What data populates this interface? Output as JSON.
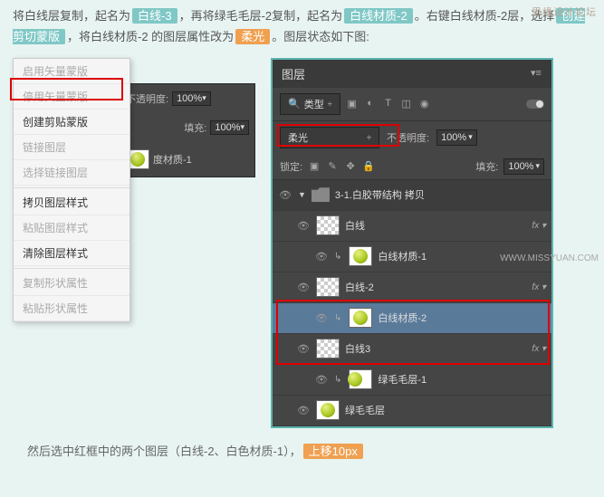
{
  "watermark": "思缘设计论坛",
  "watermark2": "WWW.MISSYUAN.COM",
  "instruction": {
    "p1_a": "将白线层复制，起名为",
    "tag1": "白线-3",
    "p1_b": "，再将绿毛毛层-2复制，起名为",
    "tag2": "白线材质-2",
    "p1_c": "。右键白线材质-2层，选择",
    "tag3": "创建剪切蒙版",
    "p1_d": "，将白线材质-2 的图层属性改为",
    "tag4": "柔光",
    "p1_e": "。图层状态如下图:"
  },
  "context_menu": {
    "i0a": "启用矢量蒙版",
    "i0b": "停用矢量蒙版",
    "i1": "创建剪贴蒙版",
    "i2": "链接图层",
    "i3": "选择链接图层",
    "i4": "拷贝图层样式",
    "i5": "粘贴图层样式",
    "i6": "清除图层样式",
    "i7": "复制形状属性",
    "i8": "粘贴形状属性"
  },
  "mini_panel": {
    "opacity_lbl": "不透明度:",
    "opacity": "100%",
    "fill_lbl": "填充:",
    "fill": "100%",
    "layer1": "度材质-1"
  },
  "layers": {
    "title": "图层",
    "filter_type": "类型",
    "blend": "柔光",
    "opacity_lbl": "不透明度:",
    "opacity": "100%",
    "lock_lbl": "锁定:",
    "fill_lbl": "填充:",
    "fill": "100%",
    "group": "3-1.白胶带结构 拷贝",
    "l1": "白线",
    "l2": "白线材质-1",
    "l3": "白线-2",
    "l4": "白线材质-2",
    "l5": "白线3",
    "l6": "绿毛毛层-1",
    "l7": "绿毛毛层"
  },
  "footer": {
    "a": "然后选中红框中的两个图层（白线-2、白色材质-1），",
    "tag": "上移10px"
  }
}
